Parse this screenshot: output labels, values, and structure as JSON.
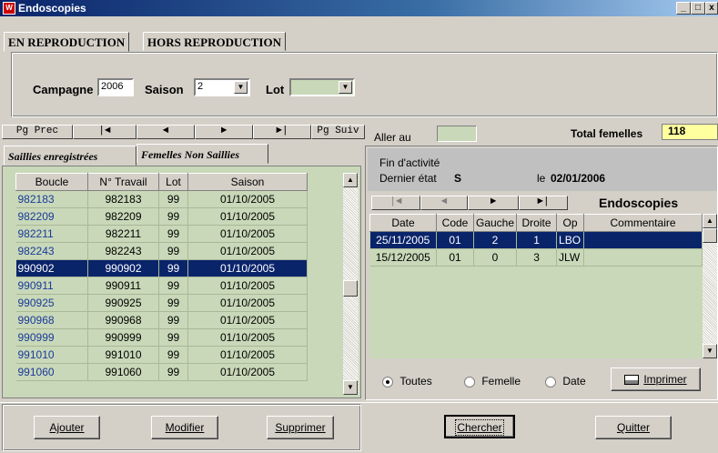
{
  "window": {
    "title": "Endoscopies",
    "icon_text": "W",
    "min": "_",
    "max": "□",
    "close": "x"
  },
  "tabs": [
    "EN REPRODUCTION",
    "HORS REPRODUCTION"
  ],
  "filters": {
    "campagne_label": "Campagne",
    "campagne_value": "2006",
    "saison_label": "Saison",
    "saison_value": "2",
    "lot_label": "Lot",
    "lot_value": ""
  },
  "nav": {
    "pg_prec": "Pg Prec",
    "first": "|◄",
    "prev": "◄",
    "next": "►",
    "last": "►|",
    "pg_suiv": "Pg Suiv",
    "aller_au": "Aller au",
    "total_label": "Total femelles",
    "total_value": "118"
  },
  "subtabs": [
    "Saillies enregistrées",
    "Femelles Non Saillies"
  ],
  "left_table": {
    "headers": [
      "Boucle",
      "N° Travail",
      "Lot",
      "Saison"
    ],
    "rows": [
      [
        "982183",
        "982183",
        "99",
        "01/10/2005"
      ],
      [
        "982209",
        "982209",
        "99",
        "01/10/2005"
      ],
      [
        "982211",
        "982211",
        "99",
        "01/10/2005"
      ],
      [
        "982243",
        "982243",
        "99",
        "01/10/2005"
      ],
      [
        "990902",
        "990902",
        "99",
        "01/10/2005"
      ],
      [
        "990911",
        "990911",
        "99",
        "01/10/2005"
      ],
      [
        "990925",
        "990925",
        "99",
        "01/10/2005"
      ],
      [
        "990968",
        "990968",
        "99",
        "01/10/2005"
      ],
      [
        "990999",
        "990999",
        "99",
        "01/10/2005"
      ],
      [
        "991010",
        "991010",
        "99",
        "01/10/2005"
      ],
      [
        "991060",
        "991060",
        "99",
        "01/10/2005"
      ]
    ],
    "selected_index": 4
  },
  "status": {
    "fin_activite": "Fin d'activité",
    "dernier_etat_label": "Dernier état",
    "dernier_etat_value": "S",
    "le_label": "le",
    "le_value": "02/01/2006"
  },
  "endo": {
    "title": "Endoscopies",
    "first": "|◄",
    "prev": "◄",
    "next": "►",
    "last": "►|",
    "headers": [
      "Date",
      "Code",
      "Gauche",
      "Droite",
      "Op",
      "Commentaire"
    ],
    "rows": [
      [
        "25/11/2005",
        "01",
        "2",
        "1",
        "LBO",
        ""
      ],
      [
        "15/12/2005",
        "01",
        "0",
        "3",
        "JLW",
        ""
      ]
    ],
    "selected_index": 0
  },
  "radios": {
    "toutes": "Toutes",
    "femelle": "Femelle",
    "date": "Date",
    "selected": "toutes"
  },
  "buttons": {
    "imprimer": "Imprimer",
    "ajouter": "Ajouter",
    "modifier": "Modifier",
    "supprimer": "Supprimer",
    "chercher": "Chercher",
    "quitter": "Quitter"
  },
  "colors": {
    "titlebar": "#0a246a",
    "grid_bg": "#c8d8b8",
    "selection": "#0a246a",
    "total_bg": "#ffffa0"
  }
}
